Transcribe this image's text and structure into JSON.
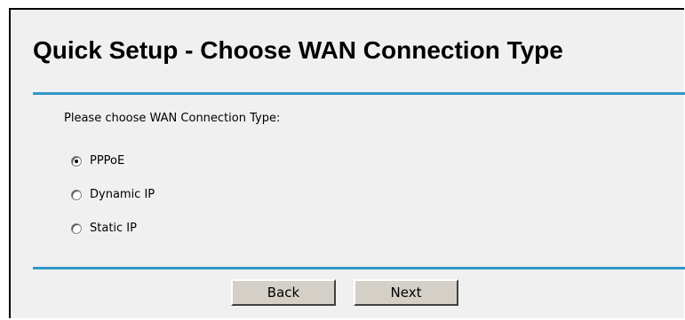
{
  "page": {
    "title": "Quick Setup - Choose WAN Connection Type",
    "prompt": "Please choose WAN Connection Type:"
  },
  "options": [
    {
      "label": "PPPoE",
      "checked": true
    },
    {
      "label": "Dynamic IP",
      "checked": false
    },
    {
      "label": "Static IP",
      "checked": false
    }
  ],
  "buttons": {
    "back": "Back",
    "next": "Next"
  },
  "colors": {
    "accent_rule": "#2e98c9",
    "panel_background": "#f0f0f0",
    "button_face": "#d4d0c8"
  }
}
